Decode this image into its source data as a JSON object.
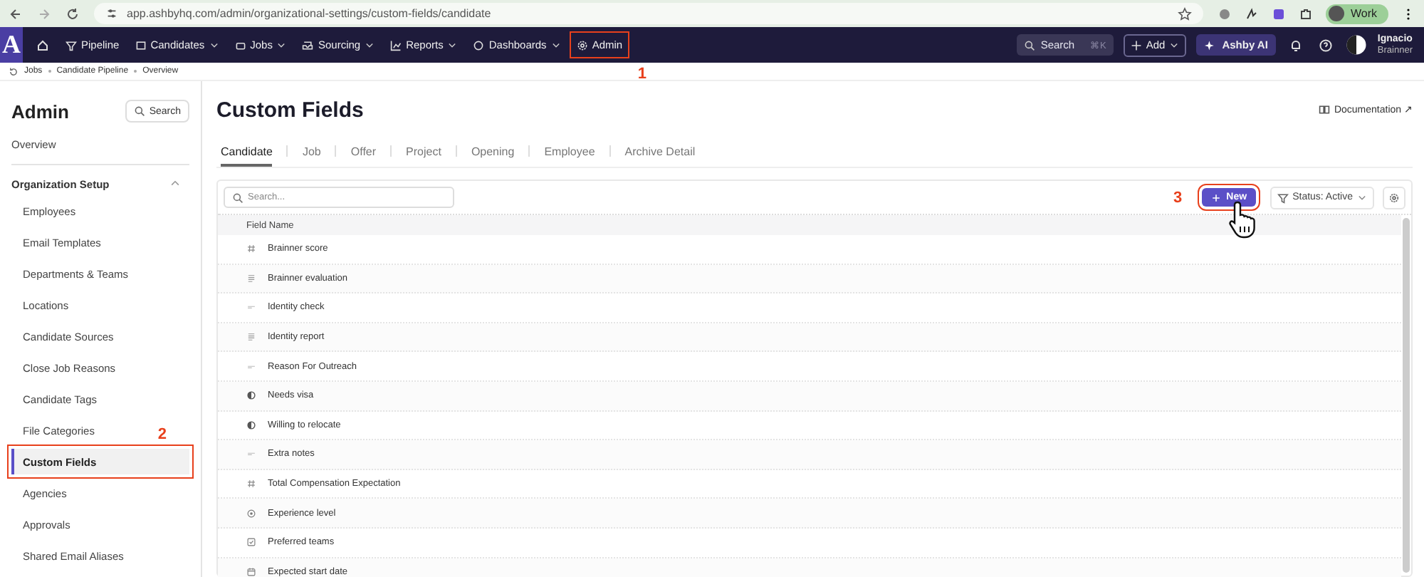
{
  "browser": {
    "url": "app.ashbyhq.com/admin/organizational-settings/custom-fields/candidate",
    "profile": "Work"
  },
  "nav": {
    "logo": "A",
    "items": [
      {
        "label": "Pipeline",
        "dropdown": false
      },
      {
        "label": "Candidates",
        "dropdown": true
      },
      {
        "label": "Jobs",
        "dropdown": true
      },
      {
        "label": "Sourcing",
        "dropdown": true
      },
      {
        "label": "Reports",
        "dropdown": true
      },
      {
        "label": "Dashboards",
        "dropdown": true
      },
      {
        "label": "Admin",
        "dropdown": false,
        "callout": "1"
      }
    ],
    "search": {
      "placeholder": "Search",
      "shortcut": "⌘K"
    },
    "add": "Add",
    "ai": "Ashby AI",
    "user": {
      "name": "Ignacio",
      "org": "Brainner"
    }
  },
  "breadcrumb": [
    "Jobs",
    "Candidate Pipeline",
    "Overview"
  ],
  "sidebar": {
    "title": "Admin",
    "search": "Search",
    "overview": "Overview",
    "section": {
      "label": "Organization Setup",
      "expanded": true,
      "items": [
        {
          "label": "Employees",
          "selected": false
        },
        {
          "label": "Email Templates",
          "selected": false
        },
        {
          "label": "Departments & Teams",
          "selected": false
        },
        {
          "label": "Locations",
          "selected": false
        },
        {
          "label": "Candidate Sources",
          "selected": false
        },
        {
          "label": "Close Job Reasons",
          "selected": false
        },
        {
          "label": "Candidate Tags",
          "selected": false
        },
        {
          "label": "File Categories",
          "selected": false
        },
        {
          "label": "Custom Fields",
          "selected": true,
          "callout": "2"
        },
        {
          "label": "Agencies",
          "selected": false
        },
        {
          "label": "Approvals",
          "selected": false
        },
        {
          "label": "Shared Email Aliases",
          "selected": false
        }
      ]
    }
  },
  "page": {
    "title": "Custom Fields",
    "documentation": "Documentation ↗",
    "tabs": [
      {
        "label": "Candidate",
        "selected": true
      },
      {
        "label": "Job",
        "selected": false
      },
      {
        "label": "Offer",
        "selected": false
      },
      {
        "label": "Project",
        "selected": false
      },
      {
        "label": "Opening",
        "selected": false
      },
      {
        "label": "Employee",
        "selected": false
      },
      {
        "label": "Archive Detail",
        "selected": false
      }
    ],
    "search": {
      "placeholder": "Search..."
    },
    "new_button": {
      "label": "New",
      "callout": "3"
    },
    "status_filter": "Status: Active",
    "table": {
      "columns": [
        "Field Name"
      ],
      "rows": [
        {
          "kind": "number",
          "name": "Brainner score"
        },
        {
          "kind": "long_text",
          "name": "Brainner evaluation"
        },
        {
          "kind": "short_text",
          "name": "Identity check"
        },
        {
          "kind": "long_text",
          "name": "Identity report"
        },
        {
          "kind": "short_text",
          "name": "Reason For Outreach"
        },
        {
          "kind": "boolean",
          "name": "Needs visa"
        },
        {
          "kind": "boolean",
          "name": "Willing to relocate"
        },
        {
          "kind": "short_text",
          "name": "Extra notes"
        },
        {
          "kind": "number",
          "name": "Total Compensation Expectation"
        },
        {
          "kind": "select",
          "name": "Experience level"
        },
        {
          "kind": "multi_select",
          "name": "Preferred teams"
        },
        {
          "kind": "date",
          "name": "Expected start date"
        }
      ]
    }
  }
}
